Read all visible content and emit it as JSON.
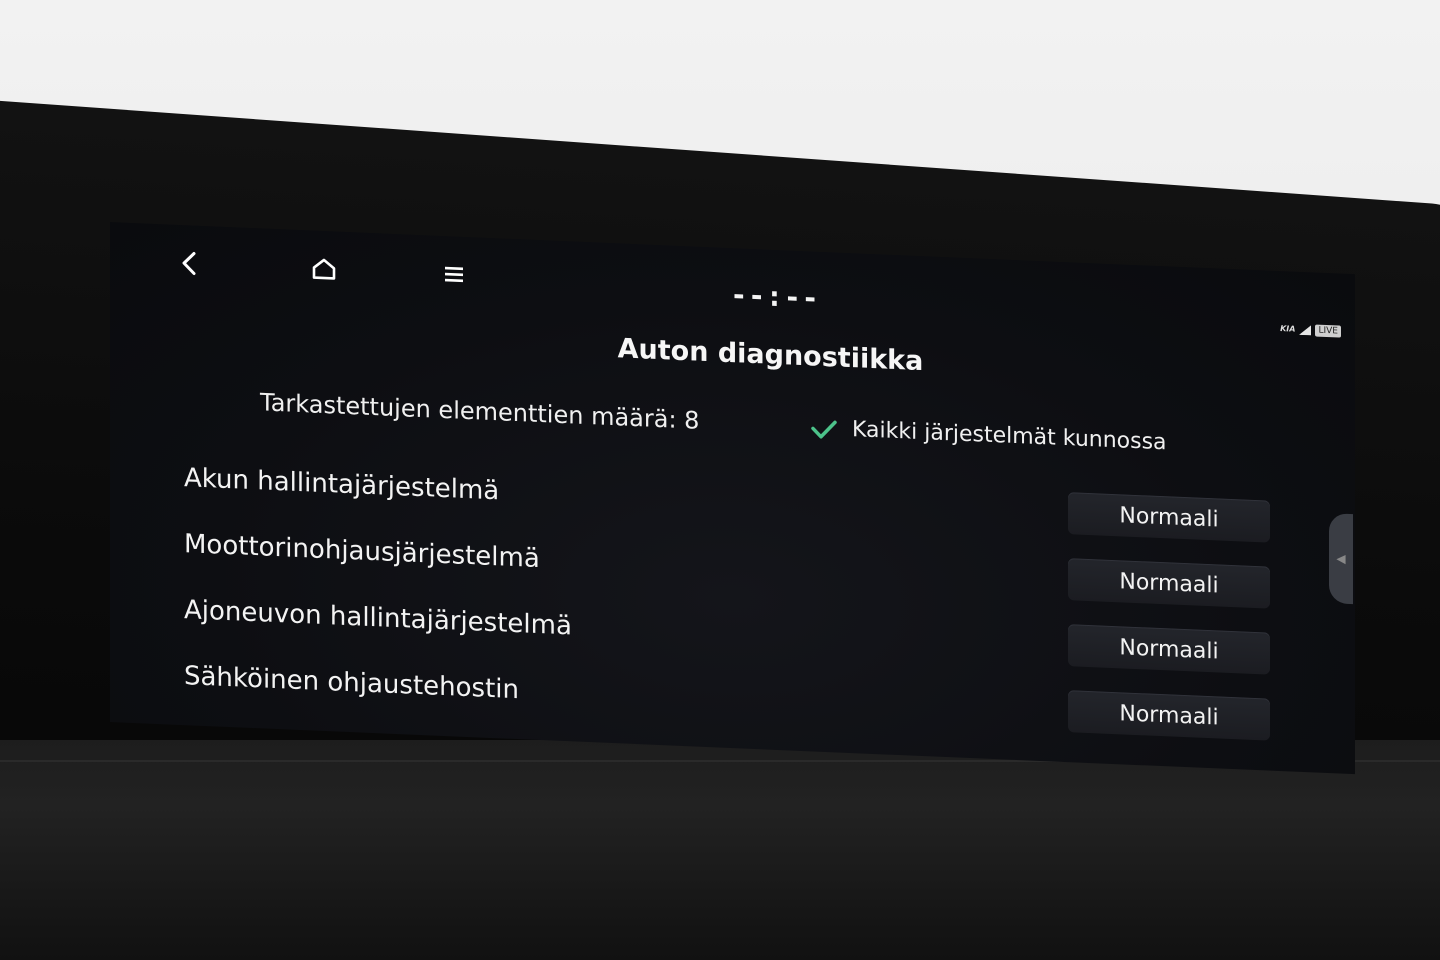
{
  "topbar": {
    "back_icon": "back-chevron-icon",
    "home_icon": "home-icon",
    "menu_icon": "menu-icon",
    "clock": "--:--",
    "brand": "KIA",
    "live_badge": "LIVE"
  },
  "page": {
    "title": "Auton diagnostiikka",
    "summary": "Tarkastettujen elementtien määrä: 8",
    "ok_status": "Kaikki järjestelmät kunnossa"
  },
  "rows": [
    {
      "label": "Akun hallintajärjestelmä",
      "status": "Normaali"
    },
    {
      "label": "Moottorinohjausjärjestelmä",
      "status": "Normaali"
    },
    {
      "label": "Ajoneuvon hallintajärjestelmä",
      "status": "Normaali"
    },
    {
      "label": "Sähköinen ohjaustehostin",
      "status": "Normaali"
    }
  ],
  "colors": {
    "check": "#4cc28a",
    "screen_bg": "#0d0e12",
    "button_bg": "#1f2126"
  }
}
